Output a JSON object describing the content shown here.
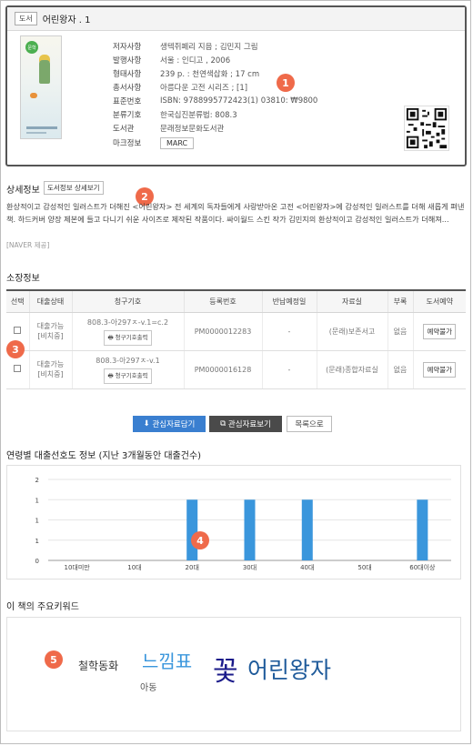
{
  "book": {
    "type_tag": "도서",
    "title": "어린왕자 . 1",
    "cover_badge": "문학",
    "meta": [
      {
        "label": "저자사항",
        "value": "생텍쥐페리 지음 ; 김민지 그림"
      },
      {
        "label": "발행사항",
        "value": "서울 : 인디고 , 2006"
      },
      {
        "label": "형태사항",
        "value": "239 p. : 천연색삽화 ; 17 cm"
      },
      {
        "label": "총서사항",
        "value": "아름다운 고전 시리즈 ; [1]"
      },
      {
        "label": "표준번호",
        "value": "ISBN: 9788995772423(1) 03810: ₩9800"
      },
      {
        "label": "분류기호",
        "value": "한국십진분류법: 808.3"
      },
      {
        "label": "도서관",
        "value": "문래정보문화도서관"
      },
      {
        "label": "마크정보",
        "value": "MARC"
      }
    ]
  },
  "markers": [
    "1",
    "2",
    "3",
    "4",
    "5"
  ],
  "detail": {
    "title": "상세정보",
    "button": "도서정보 상세보기",
    "text": "환상적이고 감성적인 일러스트가 더해진 <어린왕자> 전 세계의 독자들에게 사랑받아온 고전 <어린왕자>에 감성적인 일러스트를 더해 새롭게 펴낸 책. 하드커버 양장 제본에 들고 다니기 쉬운 사이즈로 제작된 작품이다. 싸이월드 스킨 작가 김민지의 환상적이고 감성적인 일러스트가 더해져...",
    "source": "[NAVER 제공]"
  },
  "holdings": {
    "title": "소장정보",
    "columns": [
      "선택",
      "대출상태",
      "청구기호",
      "등록번호",
      "반납예정일",
      "자료실",
      "부록",
      "도서예약"
    ],
    "print_label": "청구기호출력",
    "rows": [
      {
        "status1": "대출가능",
        "status2": "[비치중]",
        "call": "808.3-아297ㅈ-v.1=c.2",
        "reg": "PM0000012283",
        "due": "-",
        "room": "(문래)보존서고",
        "appendix": "없음",
        "reserve": "예약불가"
      },
      {
        "status1": "대출가능",
        "status2": "[비치중]",
        "call": "808.3-아297ㅈ-v.1",
        "reg": "PM0000016128",
        "due": "-",
        "room": "(문래)종합자료실",
        "appendix": "없음",
        "reserve": "예약불가"
      }
    ]
  },
  "actions": {
    "add_interest": "관심자료담기",
    "view_interest": "관심자료보기",
    "to_list": "목록으로"
  },
  "chart_title": "연령별 대출선호도 정보 (지난 3개월동안 대출건수)",
  "chart_data": {
    "type": "bar",
    "categories": [
      "10대미만",
      "10대",
      "20대",
      "30대",
      "40대",
      "50대",
      "60대이상"
    ],
    "values": [
      0,
      0,
      1,
      1,
      1,
      0,
      1
    ],
    "yticks": [
      "2",
      "1",
      "1",
      "1",
      "0"
    ],
    "ylim": [
      0,
      2
    ],
    "title": "",
    "xlabel": "",
    "ylabel": "",
    "color": "#3a96dc"
  },
  "keywords": {
    "title": "이 책의 주요키워드",
    "items": [
      {
        "text": "철학동화",
        "color": "#333333"
      },
      {
        "text": "느낌표",
        "color": "#3a96dc"
      },
      {
        "text": "아동",
        "color": "#555555"
      },
      {
        "text": "꽃",
        "color": "#1a1a8a"
      },
      {
        "text": "어린왕자",
        "color": "#1e5a9a"
      }
    ]
  }
}
